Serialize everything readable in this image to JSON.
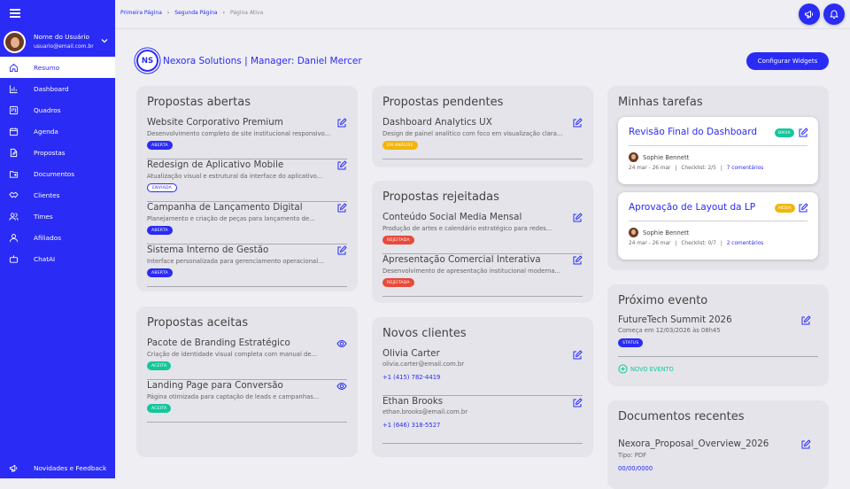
{
  "sidebar": {
    "user": {
      "name": "Nome do Usuário",
      "email": "usuario@email.com.br"
    },
    "items": [
      {
        "label": "Resumo",
        "icon": "home-icon",
        "active": true
      },
      {
        "label": "Dashboard",
        "icon": "bar-chart-icon"
      },
      {
        "label": "Quadros",
        "icon": "board-icon"
      },
      {
        "label": "Agenda",
        "icon": "calendar-icon"
      },
      {
        "label": "Propostas",
        "icon": "document-edit-icon"
      },
      {
        "label": "Documentos",
        "icon": "folder-icon"
      },
      {
        "label": "Clientes",
        "icon": "handshake-icon"
      },
      {
        "label": "Times",
        "icon": "team-icon"
      },
      {
        "label": "Afiliados",
        "icon": "user-icon"
      },
      {
        "label": "ChatAI",
        "icon": "robot-icon"
      }
    ],
    "news_label": "Novidades e Feedback"
  },
  "breadcrumb": [
    "Primeira Página",
    "Segunda Página",
    "Página Ativa"
  ],
  "company": {
    "initials": "NS",
    "title": "Nexora Solutions |  Manager: Daniel Mercer"
  },
  "configure_button": "Configurar Widgets",
  "open_proposals": {
    "title": "Propostas abertas",
    "items": [
      {
        "title": "Website Corporativo Premium",
        "desc": "Desenvolvimento completo de site institucional responsivo...",
        "status": "ABERTA"
      },
      {
        "title": "Redesign de Aplicativo Mobile",
        "desc": "Atualização visual e estrutural da interface do aplicativo...",
        "status": "ENVIADA"
      },
      {
        "title": "Campanha de Lançamento Digital",
        "desc": "Planejamento e criação de peças para lançamento de...",
        "status": "ABERTA"
      },
      {
        "title": "Sistema Interno de Gestão",
        "desc": "Interface personalizada para gerenciamento operacional...",
        "status": "ABERTA"
      }
    ]
  },
  "accepted_proposals": {
    "title": "Propostas aceitas",
    "items": [
      {
        "title": "Pacote de Branding Estratégico",
        "desc": "Criação de identidade visual completa com manual de...",
        "status": "ACEITA"
      },
      {
        "title": "Landing Page para Conversão",
        "desc": "Página otimizada para captação de leads e campanhas...",
        "status": "ACEITA"
      }
    ]
  },
  "pending_proposals": {
    "title": "Propostas pendentes",
    "items": [
      {
        "title": "Dashboard Analytics UX",
        "desc": "Design de painel analítico com foco em visualização clara...",
        "status": "EM ANÁLISE"
      }
    ]
  },
  "rejected_proposals": {
    "title": "Propostas rejeitadas",
    "items": [
      {
        "title": "Conteúdo Social Media Mensal",
        "desc": "Produção de artes e calendário estratégico para redes...",
        "status": "REJEITADA"
      },
      {
        "title": "Apresentação Comercial Interativa",
        "desc": "Desenvolvimento de apresentação institucional moderna...",
        "status": "REJEITADA"
      }
    ]
  },
  "new_clients": {
    "title": "Novos clientes",
    "items": [
      {
        "name": "Olivia Carter",
        "email": "olivia.carter@email.com.br",
        "phone": "+1 (415) 782-4419"
      },
      {
        "name": "Ethan Brooks",
        "email": "ethan.brooks@email.com.br",
        "phone": "+1 (646) 318-5527"
      }
    ]
  },
  "tasks": {
    "title": "Minhas tarefas",
    "items": [
      {
        "title": "Revisão Final do Dashboard",
        "priority": "BAIXA",
        "priority_color": "#14c79b",
        "assignee": "Sophie Bennett",
        "dates": "24 mar - 26 mar",
        "checklist": "Checklist: 2/5",
        "comments": "7 comentários"
      },
      {
        "title": "Aprovação de Layout da LP",
        "priority": "MÉDIA",
        "priority_color": "#f2b50b",
        "assignee": "Sophie Bennett",
        "dates": "24 mar - 26 mar",
        "checklist": "Checklist: 0/7",
        "comments": "2 comentários"
      }
    ]
  },
  "next_event": {
    "title": "Próximo evento",
    "event": "FutureTech Summit 2026",
    "when": "Começa em 12/03/2026 às 08h45",
    "status": "STATUS",
    "new_label": "NOVO EVENTO"
  },
  "recent_docs": {
    "title": "Documentos recentes",
    "name": "Nexora_Proposal_Overview_2026",
    "type": "Tipo: PDF",
    "date": "00/00/0000"
  },
  "colors": {
    "primary": "#2a2bf5",
    "teal": "#14c79b",
    "yellow": "#f2b50b",
    "red": "#e84a3a"
  }
}
